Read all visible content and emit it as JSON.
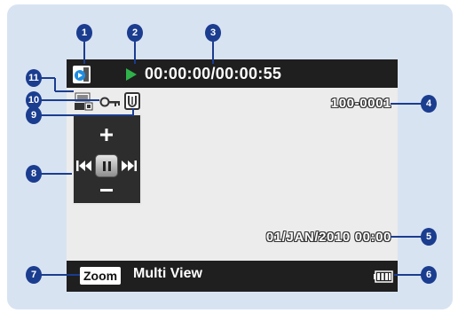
{
  "top_bar": {
    "timecode": "00:00:00/00:00:55",
    "icons": [
      "playback-mode-icon",
      "play-status-icon"
    ]
  },
  "overlay": {
    "file_number": "100-0001",
    "datetime": "01/JAN/2010 00:00",
    "icons": [
      "resolution-720-hd-icon",
      "protect-key-icon",
      "anti-shake-icon"
    ]
  },
  "control_panel": {
    "buttons": [
      "volume-up",
      "previous",
      "pause",
      "next",
      "volume-down"
    ]
  },
  "bottom_bar": {
    "zoom_label": "Zoom",
    "multiview_label": "Multi View",
    "battery": "full"
  },
  "callouts": [
    "1",
    "2",
    "3",
    "4",
    "5",
    "6",
    "7",
    "8",
    "9",
    "10",
    "11"
  ],
  "colors": {
    "panel_bg": "#d8e3f2",
    "bar_bg": "#1f1f1f",
    "callout": "#1b3d8f",
    "play_green": "#2fb24a"
  }
}
